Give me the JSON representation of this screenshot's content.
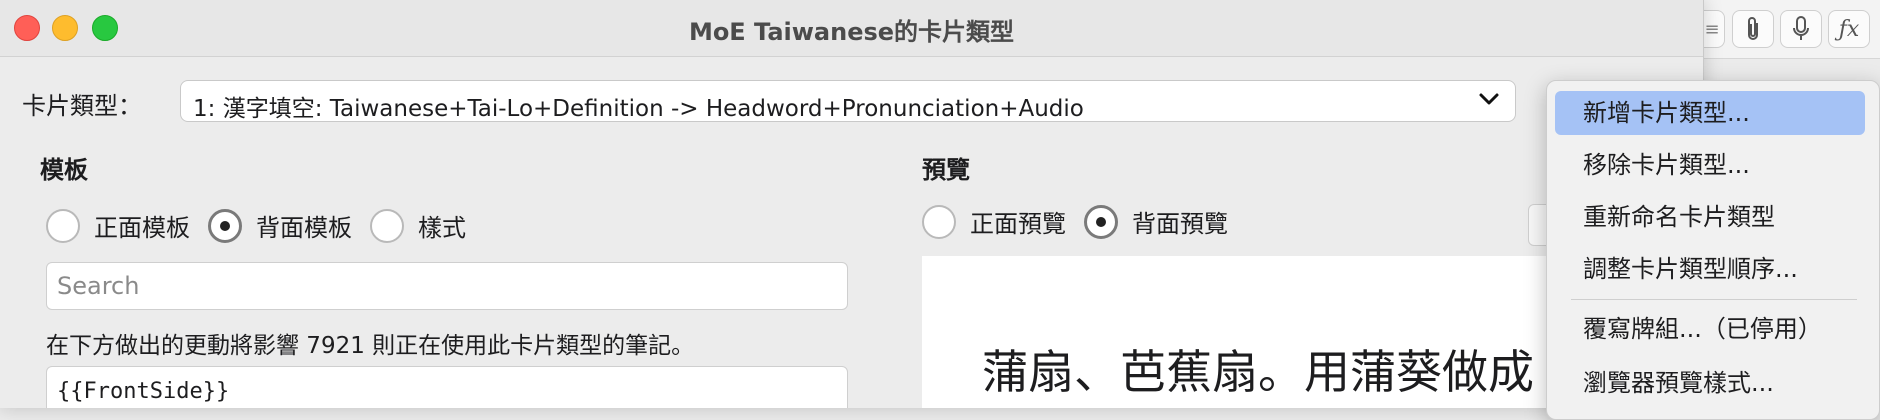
{
  "window": {
    "title": "MoE Taiwanese的卡片類型"
  },
  "note_type": {
    "label": "卡片類型：",
    "selected": "1: 漢字填空: Taiwanese+Tai-Lo+Definition -> Headword+Pronunciation+Audio"
  },
  "template": {
    "title": "模板",
    "options": [
      "正面模板",
      "背面模板",
      "樣式"
    ],
    "selected_index": 1,
    "search_placeholder": "Search",
    "notice": "在下方做出的更動將影響 7921 則正在使用此卡片類型的筆記。",
    "editor_text": "{{FrontSide}}"
  },
  "preview": {
    "title": "預覽",
    "options": [
      "正面預覽",
      "背面預覽"
    ],
    "selected_index": 1,
    "content_line1": "蒲扇、芭蕉扇。用蒲葵做成"
  },
  "menu": {
    "items": [
      "新增卡片類型...",
      "移除卡片類型...",
      "重新命名卡片類型",
      "調整卡片類型順序...",
      "覆寫牌組...（已停用）",
      "瀏覽器預覽樣式..."
    ],
    "highlighted_index": 0
  },
  "colors": {
    "highlight": "#a5c2f5",
    "close": "#ff5f57",
    "minimize": "#febc2e",
    "zoom": "#28c840"
  },
  "icons": [
    "paperclip-icon",
    "microphone-icon",
    "function-icon",
    "chevron-down-icon"
  ]
}
